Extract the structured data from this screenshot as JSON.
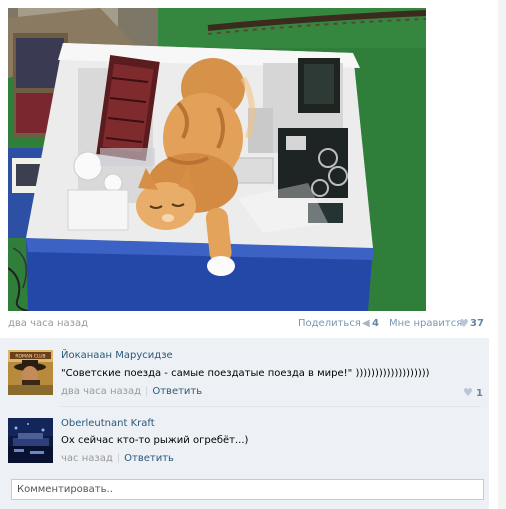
{
  "post": {
    "photo_alt": "",
    "time": "два часа назад",
    "share_label": "Поделиться",
    "share_icon": "megaphone-icon",
    "share_count": "4",
    "like_label": "Мне нравится",
    "like_icon": "heart-icon",
    "like_count": "37"
  },
  "comments": [
    {
      "author": "Йоканаан Марусидзе",
      "text": "\"Советские поезда - самые поездатые поезда в мире!\" )))))))))))))))))))",
      "time": "два часа назад",
      "reply_label": "Ответить",
      "like_icon": "heart-icon",
      "like_count": "1",
      "avatar_badge": "ROMAN CLUB"
    },
    {
      "author": "Oberleutnant Kraft",
      "text": "Ох сейчас кто-то рыжий огребёт...)",
      "time": "час назад",
      "reply_label": "Ответить"
    }
  ],
  "composer": {
    "placeholder": "Комментировать.."
  },
  "colors": {
    "link": "#2b587a",
    "muted": "#999999",
    "comments_bg": "#edf1f5",
    "grass": "#2d7a38"
  }
}
